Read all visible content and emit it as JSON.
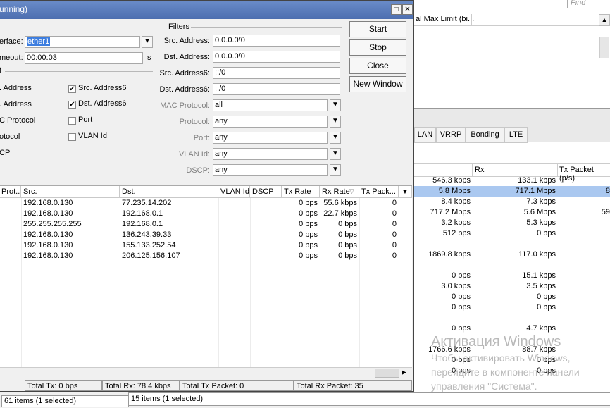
{
  "background": {
    "find_placeholder": "Find",
    "header_col1": "al Max Limit (bi...",
    "tabs": [
      "LAN",
      "VRRP",
      "Bonding",
      "LTE"
    ],
    "table_headers": [
      "Rx",
      "Tx Packet (p/s)"
    ],
    "rows": [
      {
        "a": "546.3 kbps",
        "b": "133.1 kbps",
        "c": "",
        "sel": false
      },
      {
        "a": "5.8 Mbps",
        "b": "717.1 Mbps",
        "c": "8",
        "sel": true
      },
      {
        "a": "8.4 kbps",
        "b": "7.3 kbps",
        "c": "",
        "sel": false
      },
      {
        "a": "717.2 Mbps",
        "b": "5.6 Mbps",
        "c": "59",
        "sel": false
      },
      {
        "a": "3.2 kbps",
        "b": "5.3 kbps",
        "c": "",
        "sel": false
      },
      {
        "a": "512 bps",
        "b": "0 bps",
        "c": "",
        "sel": false
      },
      {
        "a": "1869.8 kbps",
        "b": "117.0 kbps",
        "c": "",
        "sel": false
      },
      {
        "a": "0 bps",
        "b": "15.1 kbps",
        "c": "",
        "sel": false
      },
      {
        "a": "3.0 kbps",
        "b": "3.5 kbps",
        "c": "",
        "sel": false
      },
      {
        "a": "0 bps",
        "b": "0 bps",
        "c": "",
        "sel": false
      },
      {
        "a": "0 bps",
        "b": "0 bps",
        "c": "",
        "sel": false
      },
      {
        "a": "0 bps",
        "b": "4.7 kbps",
        "c": "",
        "sel": false
      },
      {
        "a": "1766.6 kbps",
        "b": "88.7 kbps",
        "c": "",
        "sel": false
      },
      {
        "a": "0 bps",
        "b": "0 bps",
        "c": "",
        "sel": false
      },
      {
        "a": "0 bps",
        "b": "0 bps",
        "c": "",
        "sel": false
      }
    ],
    "watermark_title": "Активация Windows",
    "watermark_text": "Чтобы активировать Windows, перейдите в компоненте панели управления \"Система\".",
    "status_left": "61 items (1 selected)",
    "status_right": "15 items (1 selected)"
  },
  "dialog": {
    "title": "unning)",
    "interface_label": "erface:",
    "interface_value": "ether1",
    "timeout_label": "meout:",
    "timeout_value": "00:00:03",
    "timeout_unit": "s",
    "section_left": "t",
    "section_filters": "Filters",
    "checkboxes_left": [
      {
        "label": ". Address",
        "checked": null
      },
      {
        "label": ". Address",
        "checked": null
      },
      {
        "label": "C Protocol",
        "checked": null
      },
      {
        "label": "otocol",
        "checked": null
      },
      {
        "label": "CP",
        "checked": null
      }
    ],
    "checkboxes_right": [
      {
        "label": "Src. Address6",
        "checked": "✔"
      },
      {
        "label": "Dst. Address6",
        "checked": "✔"
      },
      {
        "label": "Port",
        "checked": ""
      },
      {
        "label": "VLAN Id",
        "checked": ""
      }
    ],
    "filters": [
      {
        "label": "Src. Address:",
        "value": "0.0.0.0/0",
        "dropdown": false,
        "gray": false
      },
      {
        "label": "Dst. Address:",
        "value": "0.0.0.0/0",
        "dropdown": false,
        "gray": false
      },
      {
        "label": "Src. Address6:",
        "value": "::/0",
        "dropdown": false,
        "gray": false
      },
      {
        "label": "Dst. Address6:",
        "value": "::/0",
        "dropdown": false,
        "gray": false
      },
      {
        "label": "MAC Protocol:",
        "value": "all",
        "dropdown": true,
        "gray": true
      },
      {
        "label": "Protocol:",
        "value": "any",
        "dropdown": true,
        "gray": true
      },
      {
        "label": "Port:",
        "value": "any",
        "dropdown": true,
        "gray": true
      },
      {
        "label": "VLAN Id:",
        "value": "any",
        "dropdown": true,
        "gray": true
      },
      {
        "label": "DSCP:",
        "value": "any",
        "dropdown": true,
        "gray": true
      }
    ],
    "buttons": [
      "Start",
      "Stop",
      "Close",
      "New Window"
    ],
    "table": {
      "headers": [
        "Prot...",
        "Src.",
        "Dst.",
        "VLAN Id",
        "DSCP",
        "Tx Rate",
        "Rx Rate",
        "Tx Pack..."
      ],
      "rows": [
        [
          "",
          "192.168.0.130",
          "77.235.14.202",
          "",
          "",
          "0 bps",
          "55.6 kbps",
          "0"
        ],
        [
          "",
          "192.168.0.130",
          "192.168.0.1",
          "",
          "",
          "0 bps",
          "22.7 kbps",
          "0"
        ],
        [
          "",
          "255.255.255.255",
          "192.168.0.1",
          "",
          "",
          "0 bps",
          "0 bps",
          "0"
        ],
        [
          "",
          "192.168.0.130",
          "136.243.39.33",
          "",
          "",
          "0 bps",
          "0 bps",
          "0"
        ],
        [
          "",
          "192.168.0.130",
          "155.133.252.54",
          "",
          "",
          "0 bps",
          "0 bps",
          "0"
        ],
        [
          "",
          "192.168.0.130",
          "206.125.156.107",
          "",
          "",
          "0 bps",
          "0 bps",
          "0"
        ]
      ]
    },
    "totals": {
      "tx": "Total Tx: 0 bps",
      "rx": "Total Rx: 78.4 kbps",
      "tx_packet": "Total Tx Packet: 0",
      "rx_packet": "Total Rx Packet: 35"
    }
  }
}
